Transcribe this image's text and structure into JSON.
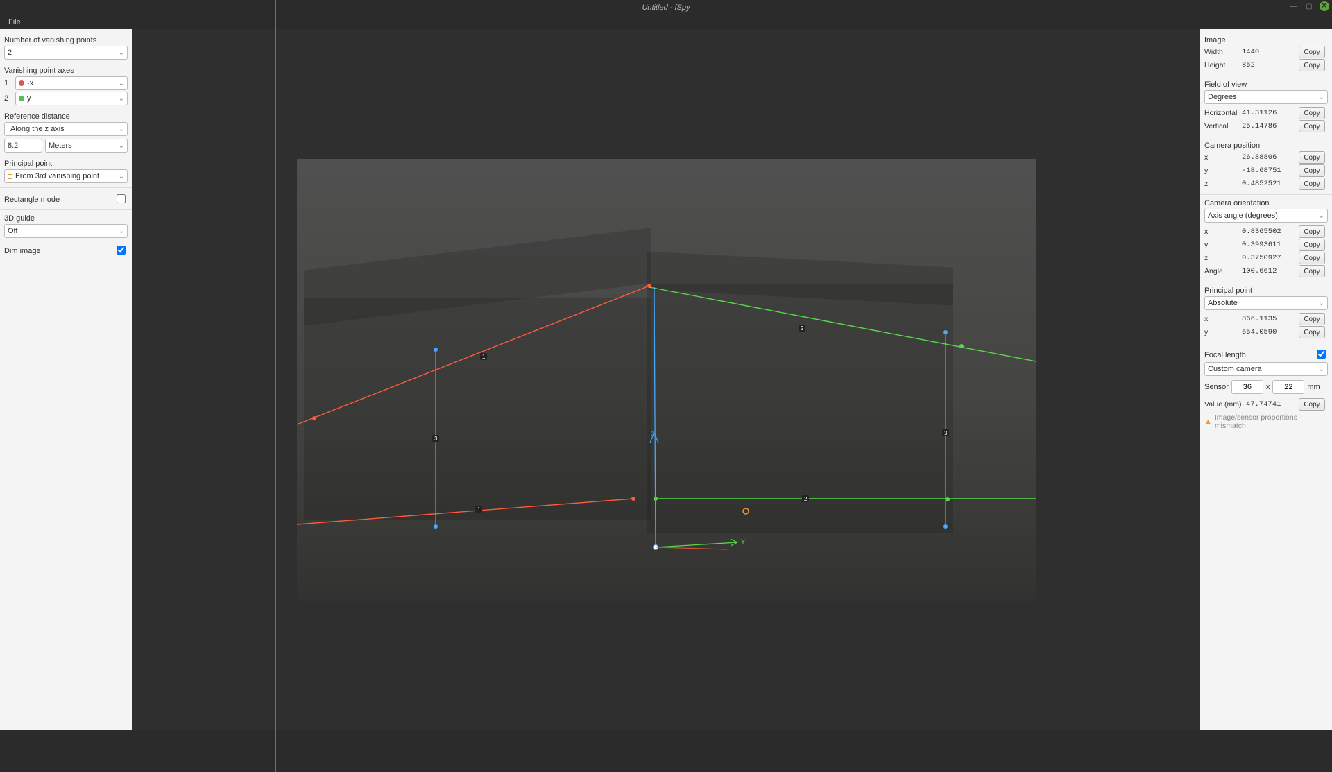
{
  "titlebar": {
    "title": "Untitled - fSpy"
  },
  "menubar": {
    "file": "File"
  },
  "left": {
    "num_vp_label": "Number of vanishing points",
    "num_vp_value": "2",
    "vp_axes_label": "Vanishing point axes",
    "axis1_num": "1",
    "axis1_value": "-x",
    "axis2_num": "2",
    "axis2_value": "y",
    "ref_dist_label": "Reference distance",
    "ref_dist_axis": "Along the z axis",
    "ref_dist_value": "8.2",
    "ref_dist_unit": "Meters",
    "pp_label": "Principal point",
    "pp_value": "From 3rd vanishing point",
    "rect_mode_label": "Rectangle mode",
    "guide_label": "3D guide",
    "guide_value": "Off",
    "dim_label": "Dim image"
  },
  "right": {
    "image_label": "Image",
    "width_label": "Width",
    "width_value": "1440",
    "height_label": "Height",
    "height_value": "852",
    "fov_label": "Field of view",
    "fov_unit": "Degrees",
    "horiz_label": "Horizontal",
    "horiz_value": "41.31126",
    "vert_label": "Vertical",
    "vert_value": "25.14786",
    "campos_label": "Camera position",
    "cx_label": "x",
    "cx_value": "26.88806",
    "cy_label": "y",
    "cy_value": "-18.68751",
    "cz_label": "z",
    "cz_value": "0.4852521",
    "camorient_label": "Camera orientation",
    "camorient_mode": "Axis angle (degrees)",
    "ox_label": "x",
    "ox_value": "0.8365502",
    "oy_label": "y",
    "oy_value": "0.3993611",
    "oz_label": "z",
    "oz_value": "0.3750927",
    "oa_label": "Angle",
    "oa_value": "100.6612",
    "ppoint_label": "Principal point",
    "ppoint_mode": "Absolute",
    "px_label": "x",
    "px_value": "866.1135",
    "py_label": "y",
    "py_value": "654.0590",
    "fl_label": "Focal length",
    "fl_camera": "Custom camera",
    "sensor_label": "Sensor",
    "sensor_w": "36",
    "sensor_x": "x",
    "sensor_h": "22",
    "sensor_mm": "mm",
    "fl_value_label": "Value (mm)",
    "fl_value": "47.74741",
    "warn": "Image/sensor proportions mismatch",
    "copy": "Copy"
  },
  "overlay": {
    "label1a": "1",
    "label1b": "1",
    "label2a": "2",
    "label2b": "2",
    "label3a": "3",
    "label3b": "3",
    "axisY": "Y",
    "axisZ": "Z"
  }
}
